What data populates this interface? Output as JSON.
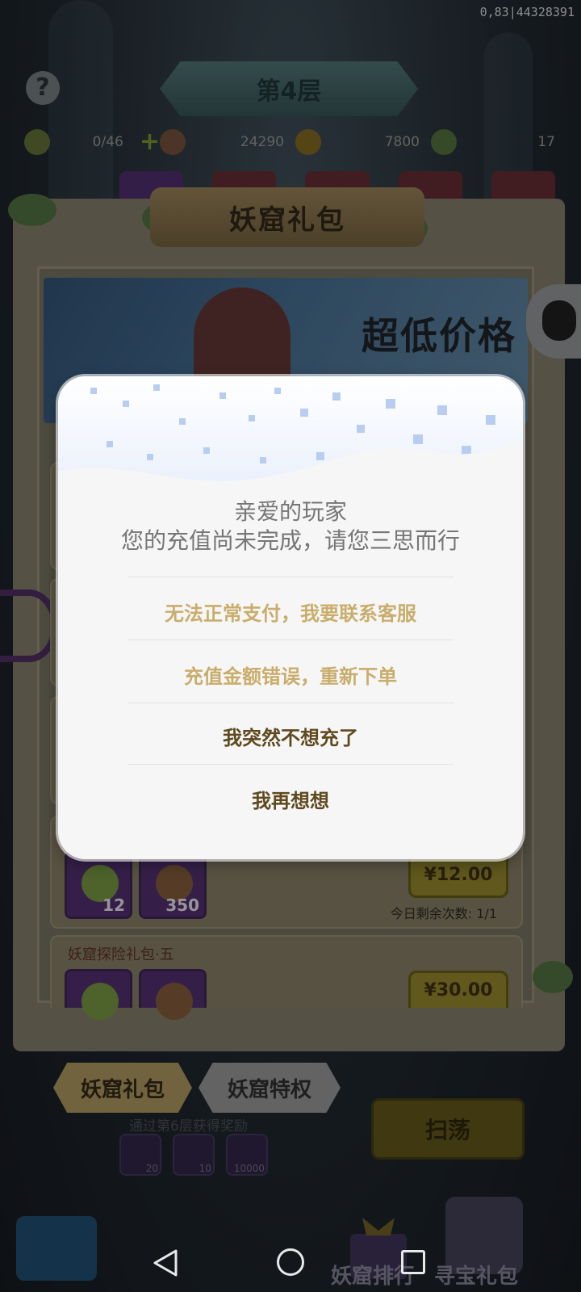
{
  "status": {
    "debug_text": "0,83|44328391"
  },
  "header": {
    "floor_title": "第4层",
    "resources": [
      {
        "icon": "gourd-icon",
        "value": "0/46",
        "has_plus": true
      },
      {
        "icon": "lotus-icon",
        "value": "24290"
      },
      {
        "icon": "gold-ingot-icon",
        "value": "7800"
      },
      {
        "icon": "jade-ring-icon",
        "value": "17"
      }
    ]
  },
  "panel": {
    "title": "妖窟礼包",
    "banner_slogan": "超低价格",
    "packages": [
      {
        "items": [
          {
            "icon": "gourd-icon",
            "qty": "12"
          },
          {
            "icon": "lotus-icon",
            "qty": "350"
          }
        ],
        "price": "¥12.00",
        "remaining": "今日剩余次数: 1/1"
      },
      {
        "label": "妖窟探险礼包·五",
        "price": "¥30.00"
      }
    ]
  },
  "tabs": {
    "active": "妖窟礼包",
    "inactive": "妖窟特权"
  },
  "footer": {
    "reward_hint": "通过第6层获得奖励",
    "rewards": [
      "20",
      "10",
      "10000"
    ],
    "sweep_label": "扫荡",
    "rank_label": "妖窟排行",
    "treasure_label": "寻宝礼包"
  },
  "dialog": {
    "line1": "亲爱的玩家",
    "line2": "您的充值尚未完成，请您三思而行",
    "options": [
      "无法正常支付，我要联系客服",
      "充值金额错误，重新下单",
      "我突然不想充了",
      "我再想想"
    ]
  },
  "colors": {
    "dialog_bg": "#f6f6f6",
    "option_gold": "#c9ad6c",
    "option_dark": "#5e4a1e",
    "message_grey": "#767676"
  }
}
